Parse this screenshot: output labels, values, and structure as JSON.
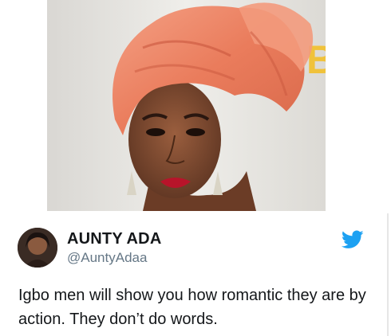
{
  "tweet": {
    "author_name": "AUNTY ADA",
    "author_handle": "@AuntyAdaa",
    "text": "Igbo men will show you how romantic they are by action. They don’t do words.",
    "logo_icon": "twitter-bird-icon",
    "logo_color": "#1da1f2"
  },
  "photo": {
    "subject": "woman in coral gele headwrap",
    "background_letter": "B"
  },
  "colors": {
    "text": "#14171a",
    "secondary": "#657786",
    "gele": "#ef8a6a"
  }
}
